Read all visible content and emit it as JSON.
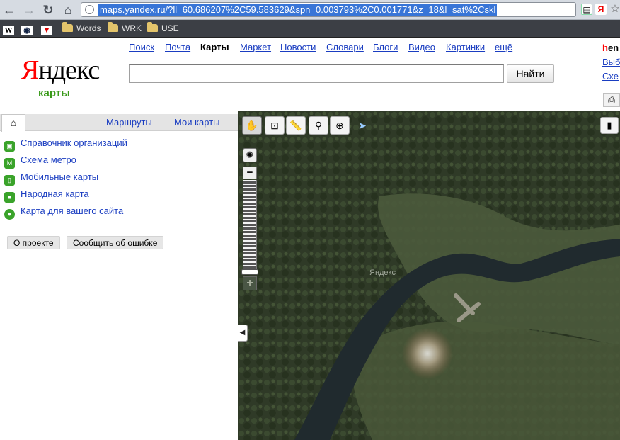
{
  "browser": {
    "url": "maps.yandex.ru/?ll=60.686207%2C59.583629&spn=0.003793%2C0.001771&z=18&l=sat%2Cskl"
  },
  "bookmarks": [
    {
      "icon": "wikipedia-icon",
      "label": ""
    },
    {
      "icon": "radio-icon",
      "label": ""
    },
    {
      "icon": "yandex-bookmark-icon",
      "label": ""
    },
    {
      "icon": "folder-icon",
      "label": "Words"
    },
    {
      "icon": "folder-icon",
      "label": "WRK"
    },
    {
      "icon": "folder-icon",
      "label": "USE"
    }
  ],
  "header": {
    "logo_first": "Я",
    "logo_rest": "ндекс",
    "logo_sub": "карты",
    "nav": [
      "Поиск",
      "Почта",
      "Карты",
      "Маркет",
      "Новости",
      "Словари",
      "Блоги",
      "Видео",
      "Картинки",
      "ещё"
    ],
    "current_nav": "Карты",
    "search_value": "",
    "search_button": "Найти",
    "right_links": {
      "login_first": "h",
      "login_rest": "en",
      "link1": "Выб",
      "link2": "Схе"
    }
  },
  "sidebar": {
    "tabs": [
      "Маршруты",
      "Мои карты"
    ],
    "links": [
      {
        "icon": "directory-icon",
        "label": "Справочник организаций"
      },
      {
        "icon": "metro-icon",
        "label": "Схема метро"
      },
      {
        "icon": "mobile-icon",
        "label": "Мобильные карты"
      },
      {
        "icon": "people-map-icon",
        "label": "Народная карта"
      },
      {
        "icon": "site-map-icon",
        "label": "Карта для вашего сайта"
      }
    ],
    "buttons": [
      "О проекте",
      "Сообщить об ошибке"
    ]
  },
  "map": {
    "watermark": "Яндекс",
    "zoom_level": 18,
    "tools": [
      "hand-tool-icon",
      "magnifier-tool-icon",
      "ruler-tool-icon",
      "route-tool-icon",
      "placemark-tool-icon",
      "pointer-tool-icon"
    ],
    "colors": {
      "forest": "#2f3a27",
      "meadow": "#4b5a3c",
      "river": "#202a2e"
    }
  }
}
